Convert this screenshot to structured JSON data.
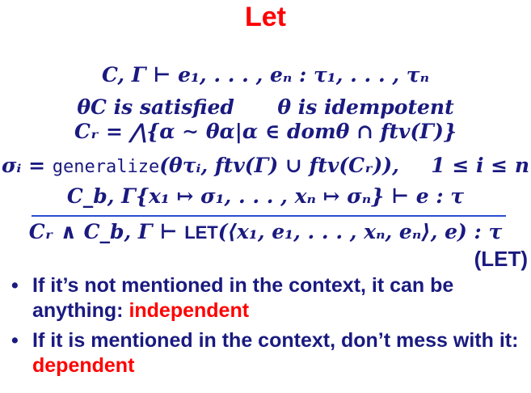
{
  "title": "Let",
  "premises": {
    "p1": "C, Γ ⊢ e₁, . . . , eₙ : τ₁, . . . , τₙ",
    "p2a": "θC is satisfied",
    "p2b": "θ is idempotent",
    "p3": "Cᵣ = ⋀{α ∼ θα|α ∈ domθ ∩ ftv(Γ)}",
    "p4a": "σᵢ = ",
    "p4b": "generalize",
    "p4c": "(θτᵢ, ftv(Γ) ∪ ftv(Cᵣ)),",
    "p4d": "1 ≤ i ≤ n",
    "p5": "C_b, Γ{x₁ ↦ σ₁, . . . , xₙ ↦ σₙ} ⊢ e : τ"
  },
  "conclusion": {
    "a": "Cᵣ ∧ C_b, Γ ⊢ ",
    "kw": "LET",
    "b": "(⟨x₁, e₁, . . . , xₙ, eₙ⟩, e) : τ"
  },
  "rule_label": "(LET)",
  "bullets": [
    {
      "text": "If it’s not mentioned in the context, it can be anything: ",
      "highlight": "independent"
    },
    {
      "text": "If it is mentioned in the context, don’t mess with it: ",
      "highlight": "dependent"
    }
  ],
  "colors": {
    "title": "#ff0000",
    "text": "#1a1a80",
    "rule": "#2a4fd0",
    "highlight": "#ff0000"
  }
}
